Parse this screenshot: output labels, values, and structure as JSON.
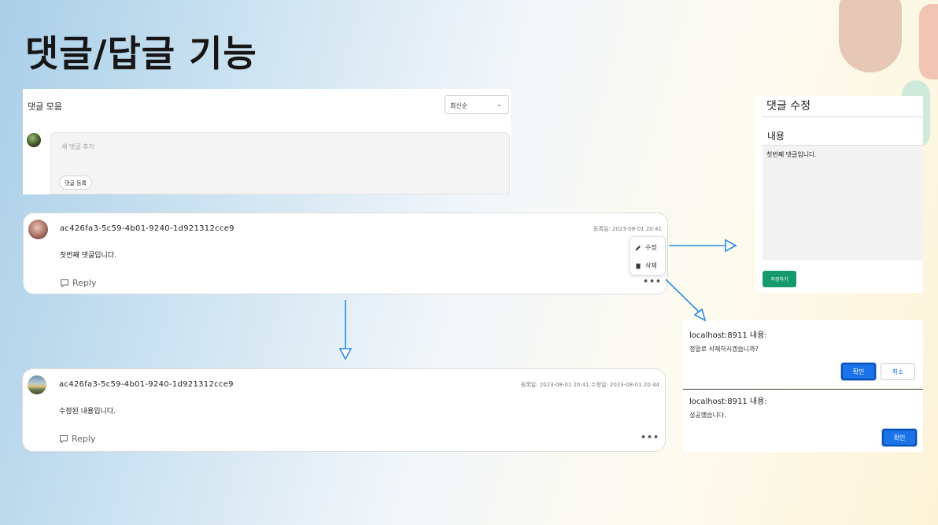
{
  "title": "댓글/답글 기능",
  "collection": {
    "title": "댓글 모음",
    "sort_selected": "최신순",
    "new_comment_placeholder": "새 댓글 추가",
    "register_button": "댓글 등록"
  },
  "comment1": {
    "user_id": "ac426fa3-5c59-4b01-9240-1d921312cce9",
    "dates": "등록일: 2023-08-01 20:41",
    "content": "첫번째 댓글입니다.",
    "reply_label": "Reply",
    "more_label": "•••",
    "menu": {
      "edit": "수정",
      "delete": "삭제"
    }
  },
  "comment2": {
    "user_id": "ac426fa3-5c59-4b01-9240-1d921312cce9",
    "dates": "등록일: 2023-08-01 20:41    수정일: 2023-08-01 20:44",
    "content": "수정된 내용입니다.",
    "reply_label": "Reply",
    "more_label": "•••"
  },
  "edit_panel": {
    "title": "댓글 수정",
    "content_label": "내용",
    "content_value": "첫번째 댓글입니다.",
    "save_button": "저장하기"
  },
  "confirm_dialog": {
    "host": "localhost:8911 내용:",
    "message": "정말로 삭제하시겠습니까?",
    "ok": "확인",
    "cancel": "취소"
  },
  "success_dialog": {
    "host": "localhost:8911 내용:",
    "message": "성공했습니다.",
    "ok": "확인"
  },
  "colors": {
    "accent_blue": "#1a73e8",
    "save_green": "#159a6b",
    "arrow_blue": "#2b8be6"
  }
}
